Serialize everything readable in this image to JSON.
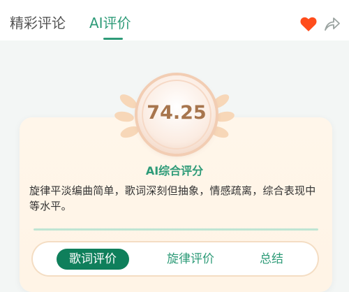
{
  "tabs": {
    "comments": "精彩评论",
    "ai_review": "AI评价"
  },
  "icons": {
    "heart": "heart-icon",
    "share": "share-icon"
  },
  "score": {
    "value": "74.25",
    "title": "AI综合评分"
  },
  "summary": "旋律平淡编曲简单，歌词深刻但抽象，情感疏离，综合表现中等水平。",
  "segments": {
    "lyrics": "歌词评价",
    "melody": "旋律评价",
    "summary": "总结"
  },
  "colors": {
    "accent": "#2e9b78",
    "active_segment": "#0f7f5b",
    "heart": "#ff4d1c",
    "score_text": "#a7754d"
  }
}
